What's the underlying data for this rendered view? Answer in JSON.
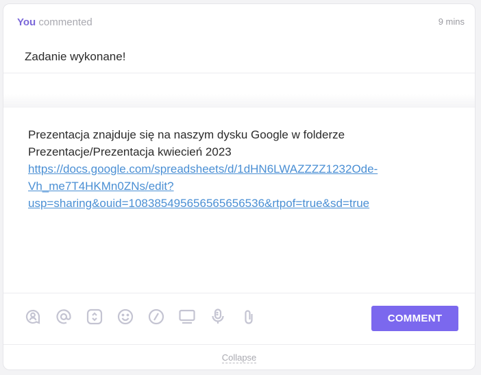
{
  "header": {
    "author": "You",
    "action": "commented",
    "time": "9 mins"
  },
  "comment": {
    "text": "Zadanie wykonane!"
  },
  "editor": {
    "line1": "Prezentacja znajduje się na naszym dysku Google w folderze",
    "line2": "Prezentacje/Prezentacja kwiecień 2023",
    "link_parts": [
      "https://docs.google.com/spreadsheets/d/1dHN6LWAZZZZ1232Ode-",
      "Vh_me7T4HKMn0ZNs/edit?",
      "usp=sharing&ouid=108385495656565656536&rtpof=true&sd=true"
    ]
  },
  "toolbar": {
    "icons": [
      "assign-comment-icon",
      "mention-icon",
      "toggle-icon",
      "emoji-icon",
      "slash-command-icon",
      "screen-record-icon",
      "microphone-icon",
      "attachment-icon"
    ],
    "comment_label": "COMMENT"
  },
  "footer": {
    "collapse_label": "Collapse"
  },
  "colors": {
    "accent": "#7b68ee",
    "link": "#4a8fd4",
    "icon": "#c4c4d2"
  }
}
